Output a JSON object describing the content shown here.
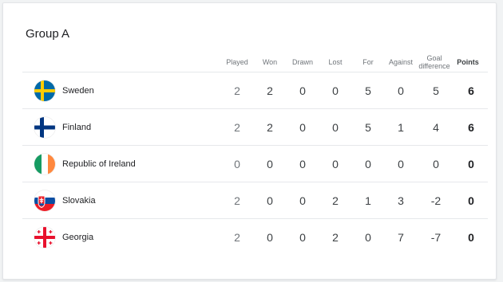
{
  "group": {
    "title": "Group A",
    "columns": {
      "played": "Played",
      "won": "Won",
      "drawn": "Drawn",
      "lost": "Lost",
      "for": "For",
      "against": "Against",
      "goal_difference": "Goal difference",
      "points": "Points"
    },
    "teams": [
      {
        "name": "Sweden",
        "flag": "sweden-flag-icon",
        "played": "2",
        "won": "2",
        "drawn": "0",
        "lost": "0",
        "for": "5",
        "against": "0",
        "gd": "5",
        "points": "6"
      },
      {
        "name": "Finland",
        "flag": "finland-flag-icon",
        "played": "2",
        "won": "2",
        "drawn": "0",
        "lost": "0",
        "for": "5",
        "against": "1",
        "gd": "4",
        "points": "6"
      },
      {
        "name": "Republic of Ireland",
        "flag": "ireland-flag-icon",
        "played": "0",
        "won": "0",
        "drawn": "0",
        "lost": "0",
        "for": "0",
        "against": "0",
        "gd": "0",
        "points": "0"
      },
      {
        "name": "Slovakia",
        "flag": "slovakia-flag-icon",
        "played": "2",
        "won": "0",
        "drawn": "0",
        "lost": "2",
        "for": "1",
        "against": "3",
        "gd": "-2",
        "points": "0"
      },
      {
        "name": "Georgia",
        "flag": "georgia-flag-icon",
        "played": "2",
        "won": "0",
        "drawn": "0",
        "lost": "2",
        "for": "0",
        "against": "7",
        "gd": "-7",
        "points": "0"
      }
    ]
  },
  "colors": {
    "played_text": "#70757a",
    "text": "#3c4043",
    "divider": "#e6e8eb"
  }
}
